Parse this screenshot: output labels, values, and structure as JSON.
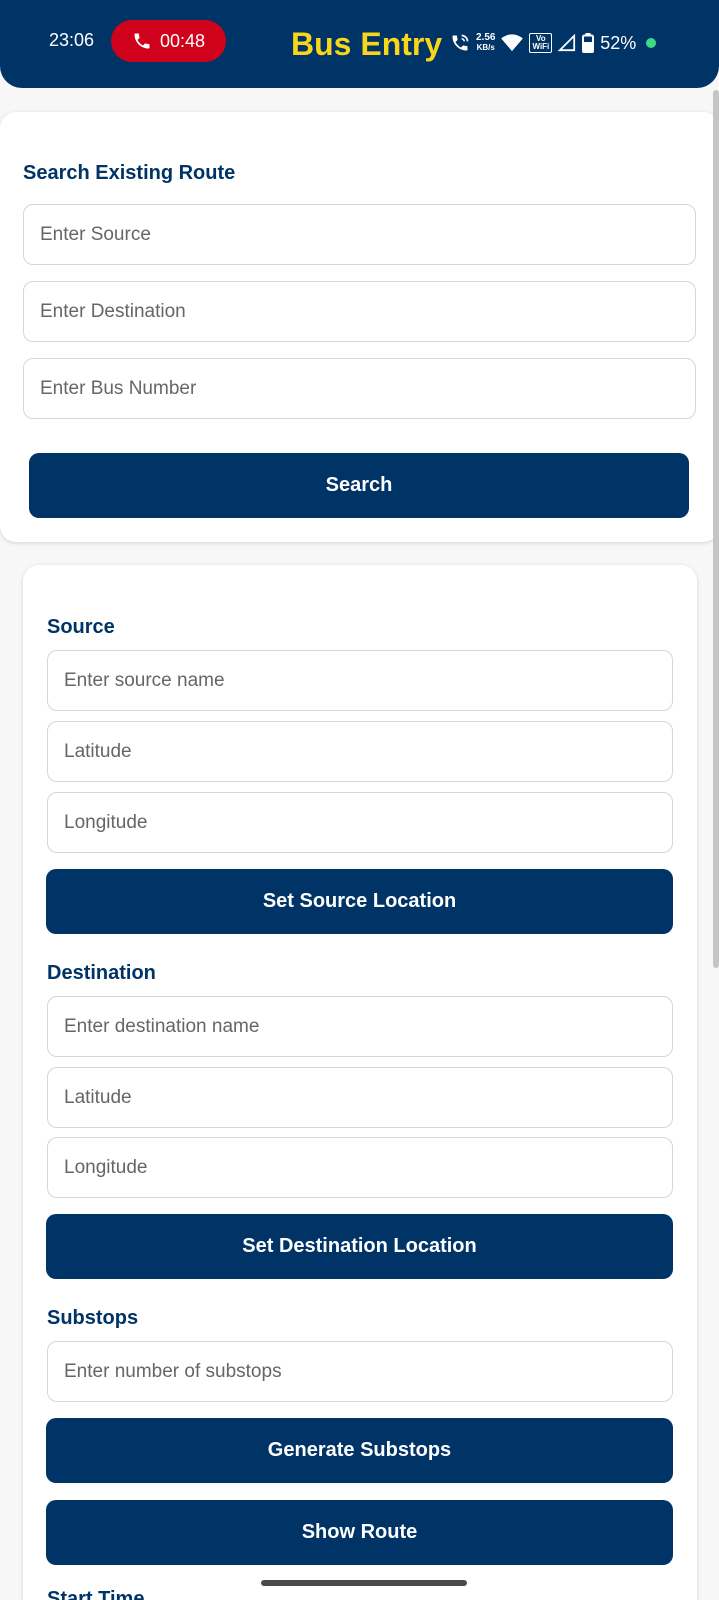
{
  "status_bar": {
    "time": "23:06",
    "call_timer": "00:48",
    "net_speed_value": "2.56",
    "net_speed_unit": "KB/s",
    "vowifi_top": "Vo",
    "vowifi_bottom": "WiFi",
    "battery": "52%"
  },
  "header": {
    "title": "Bus Entry"
  },
  "search": {
    "heading": "Search Existing Route",
    "source_placeholder": "Enter Source",
    "destination_placeholder": "Enter Destination",
    "bus_number_placeholder": "Enter Bus Number",
    "button": "Search"
  },
  "source": {
    "heading": "Source",
    "name_placeholder": "Enter source name",
    "lat_placeholder": "Latitude",
    "lng_placeholder": "Longitude",
    "button": "Set Source Location"
  },
  "destination": {
    "heading": "Destination",
    "name_placeholder": "Enter destination name",
    "lat_placeholder": "Latitude",
    "lng_placeholder": "Longitude",
    "button": "Set Destination Location"
  },
  "substops": {
    "heading": "Substops",
    "count_placeholder": "Enter number of substops",
    "generate_button": "Generate Substops",
    "show_route_button": "Show Route"
  },
  "next_section": {
    "heading": "Start Time"
  },
  "colors": {
    "primary": "#003366",
    "title_yellow": "#f8d61b",
    "call_red": "#d0021b",
    "status_dot": "#3ddc84"
  }
}
